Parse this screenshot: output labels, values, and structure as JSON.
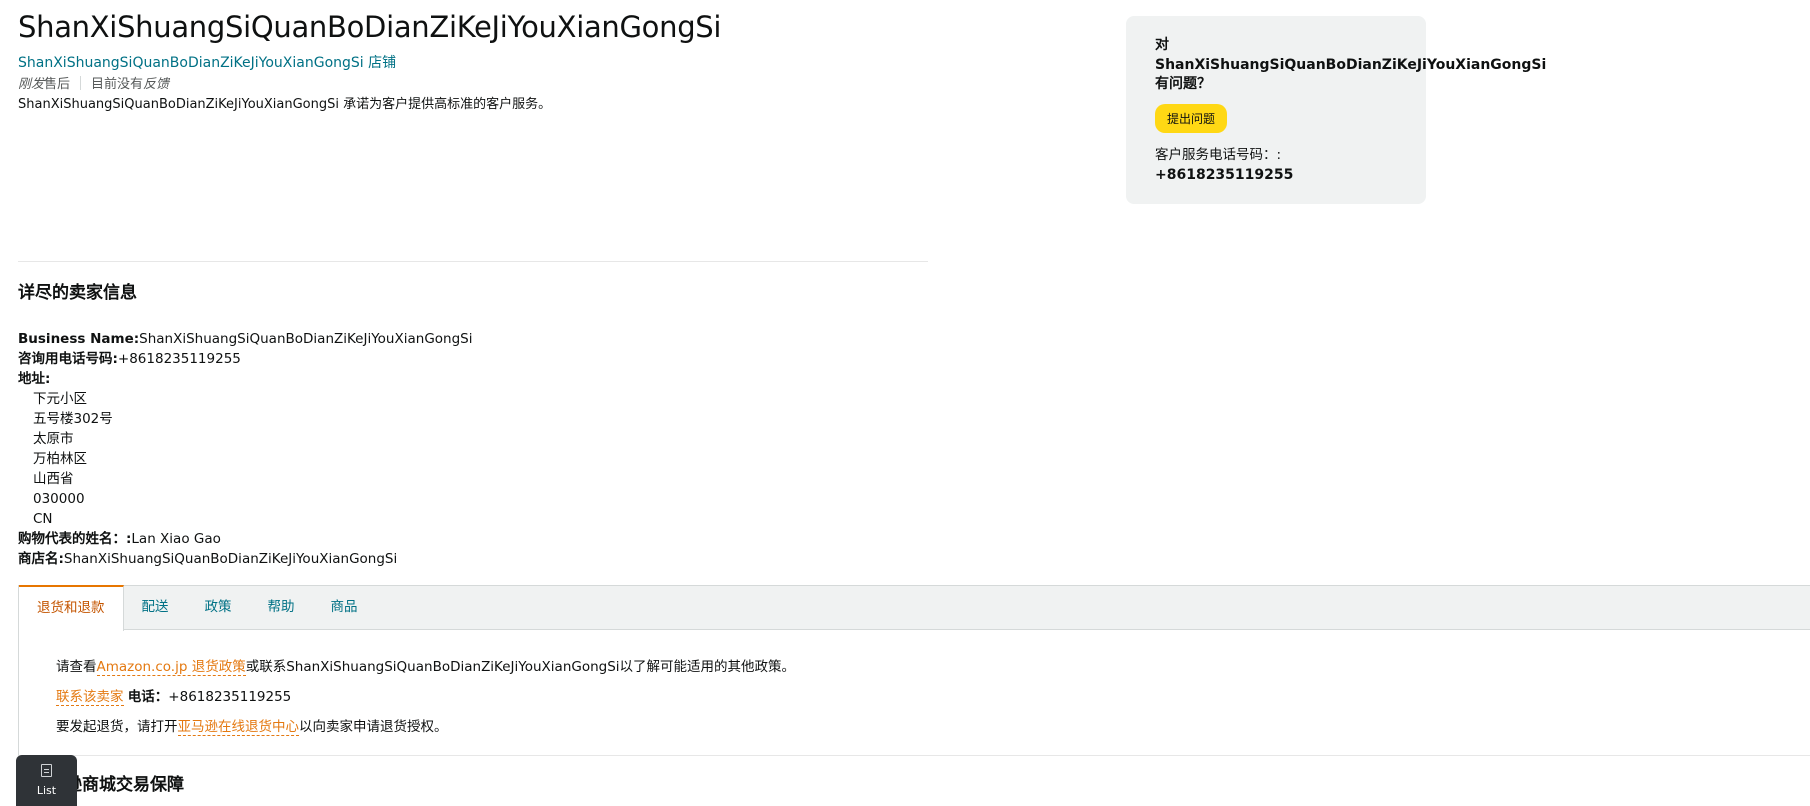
{
  "header": {
    "store_name": "ShanXiShuangSiQuanBoDianZiKeJiYouXianGongSi",
    "store_link": "ShanXiShuangSiQuanBoDianZiKeJiYouXianGongSi 店铺",
    "feedback_italic1": "刚发",
    "feedback_text1": "售后",
    "feedback_text2": "目前没有",
    "feedback_italic2": "反馈",
    "commitment": "ShanXiShuangSiQuanBoDianZiKeJiYouXianGongSi 承诺为客户提供高标准的客户服务。"
  },
  "side_box": {
    "question_prefix": "对",
    "question_name": "ShanXiShuangSiQuanBoDianZiKeJiYouXianGongSi",
    "question_suffix": "有问题？",
    "ask_button": "提出问题",
    "phone_label": "客户服务电话号码：:",
    "phone": "+8618235119255"
  },
  "details": {
    "heading": "详尽的卖家信息",
    "business_name_label": "Business Name:",
    "business_name": "ShanXiShuangSiQuanBoDianZiKeJiYouXianGongSi",
    "phone_label": "咨询用电话号码:",
    "phone": "+8618235119255",
    "address_label": "地址:",
    "address_lines": [
      "下元小区",
      "五号楼302号",
      "太原市",
      "万柏林区",
      "山西省",
      "030000",
      "CN"
    ],
    "rep_label": "购物代表的姓名：:",
    "rep": "Lan Xiao Gao",
    "shop_label": "商店名:",
    "shop": "ShanXiShuangSiQuanBoDianZiKeJiYouXianGongSi"
  },
  "tabs": [
    {
      "label": "退货和退款",
      "active": true
    },
    {
      "label": "配送",
      "active": false
    },
    {
      "label": "政策",
      "active": false
    },
    {
      "label": "帮助",
      "active": false
    },
    {
      "label": "商品",
      "active": false
    }
  ],
  "returns": {
    "line1_pre": "请查看",
    "line1_link": "Amazon.co.jp 退货政策",
    "line1_post": "或联系ShanXiShuangSiQuanBoDianZiKeJiYouXianGongSi以了解可能适用的其他政策。",
    "contact_link": "联系该卖家",
    "phone_label": "电话：",
    "phone": "+8618235119255",
    "line3_pre": "要发起退货，请打开",
    "line3_link": "亚马逊在线退货中心",
    "line3_post": "以向卖家申请退货授权。"
  },
  "bottom": {
    "heading_partial": "马逊商城交易保障"
  },
  "list_button": {
    "label": "List"
  },
  "colors": {
    "link_teal": "#007185",
    "link_orange": "#e47911",
    "active_tab": "#c45500",
    "button_yellow": "#ffd814",
    "side_box_bg": "#f0f2f2"
  }
}
